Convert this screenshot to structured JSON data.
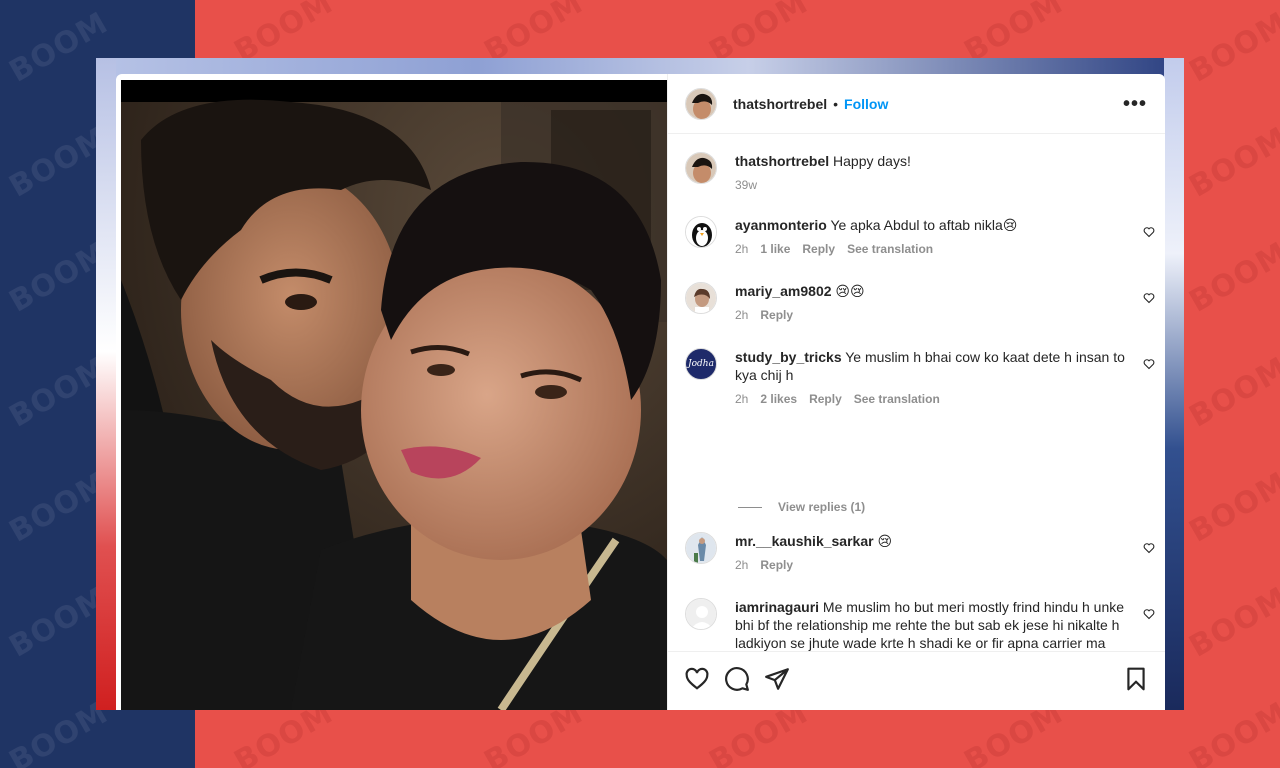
{
  "watermark": {
    "text": "BOOM"
  },
  "post": {
    "author": "thatshortrebel",
    "separator": "•",
    "follow_label": "Follow",
    "more_label": "•••"
  },
  "caption": {
    "user": "thatshortrebel",
    "text": "Happy days!",
    "time": "39w"
  },
  "comments": [
    {
      "user": "ayanmonterio",
      "text": "Ye apka Abdul to aftab nikla😢",
      "time": "2h",
      "likes": "1 like",
      "reply": "Reply",
      "translate": "See translation"
    },
    {
      "user": "mariy_am9802",
      "text": "😢😢",
      "time": "2h",
      "reply": "Reply"
    },
    {
      "user": "study_by_tricks",
      "text": "Ye muslim h bhai cow ko kaat dete h insan to kya chij h",
      "time": "2h",
      "likes": "2 likes",
      "reply": "Reply",
      "translate": "See translation",
      "avatar_text": "Jodha"
    },
    {
      "user": "mr.__kaushik_sarkar",
      "text": "😢",
      "time": "2h",
      "reply": "Reply"
    },
    {
      "user": "iamrinagauri",
      "text": "Me muslim ho but meri mostly frind hindu h unke bhi bf the relationship me rehte the but sab ek jese hi nikalte h ladkiyon se jhute wade krte h shadi ke or fir apna carrier ma bap religion bolkar chor dete h unhe bhi taras nahi aata kuch ladakiya move on kr leti h kuch suicide kr leti h kuch shadi kr leti h shraddha ne ek strong decision nahi liya wo use uski harkaten ke jelti rahi thi waha se bhi bht se"
    }
  ],
  "view_replies": "View replies (1)",
  "actions": [
    "like-icon",
    "comment-icon",
    "share-icon",
    "save-icon"
  ],
  "colors": {
    "accent": "#0095f6",
    "bg_red": "#e8504a",
    "bg_navy": "#1f3464"
  }
}
